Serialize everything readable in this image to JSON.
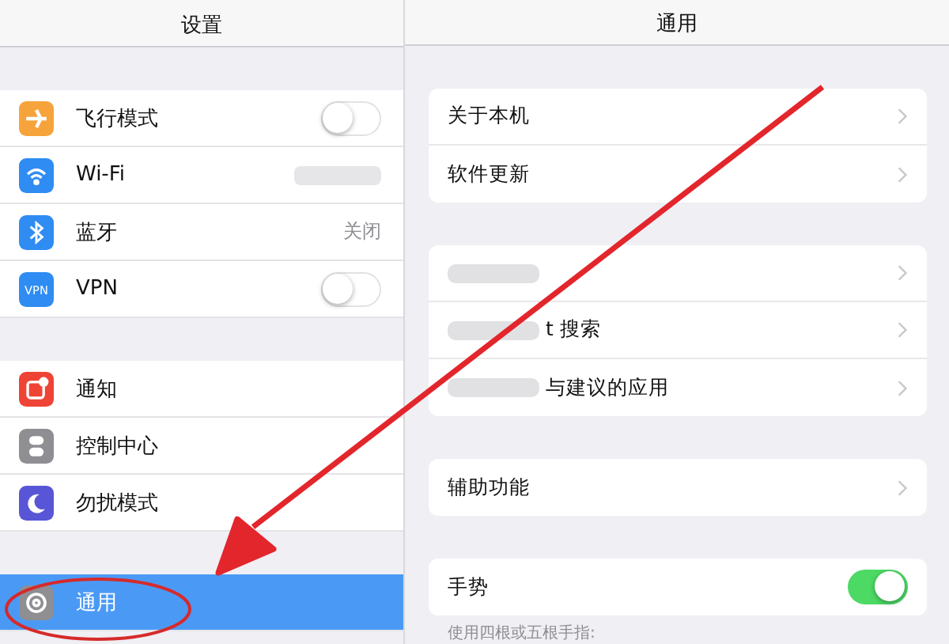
{
  "sidebar": {
    "title": "设置",
    "sections": [
      {
        "items": [
          {
            "label": "飞行模式",
            "kind": "toggle",
            "on": false,
            "selected": false,
            "color": "#f7a33b"
          },
          {
            "label": "Wi-Fi",
            "kind": "blurred",
            "selected": false,
            "color": "#2f8cf2"
          },
          {
            "label": "蓝牙",
            "kind": "value",
            "value": "关闭",
            "selected": false,
            "color": "#2f8cf2"
          },
          {
            "label": "VPN",
            "kind": "toggle",
            "on": false,
            "selected": false,
            "color": "#2f8cf2",
            "icon_text": "VPN"
          }
        ]
      },
      {
        "items": [
          {
            "label": "通知",
            "kind": "plain",
            "selected": false,
            "color": "#ee4436"
          },
          {
            "label": "控制中心",
            "kind": "plain",
            "selected": false,
            "color": "#8e8e93"
          },
          {
            "label": "勿扰模式",
            "kind": "plain",
            "selected": false,
            "color": "#5856d6"
          }
        ]
      },
      {
        "items": [
          {
            "label": "通用",
            "kind": "plain",
            "selected": true,
            "color": "#8e8e93"
          }
        ]
      }
    ]
  },
  "detail": {
    "title": "通用",
    "groups": [
      {
        "rows": [
          {
            "label": "关于本机",
            "kind": "link",
            "blurred": false
          },
          {
            "label": "软件更新",
            "kind": "link",
            "blurred": false
          }
        ]
      },
      {
        "rows": [
          {
            "kind": "link",
            "blurred": true
          },
          {
            "label": "t 搜索",
            "kind": "link",
            "blurred": true
          },
          {
            "label": "与建议的应用",
            "kind": "link",
            "blurred": true
          }
        ]
      },
      {
        "rows": [
          {
            "label": "辅助功能",
            "kind": "link",
            "blurred": false
          }
        ]
      },
      {
        "rows": [
          {
            "label": "手势",
            "kind": "toggle",
            "on": true,
            "blurred": false
          }
        ],
        "footer": "使用四根或五根手指:"
      }
    ]
  }
}
